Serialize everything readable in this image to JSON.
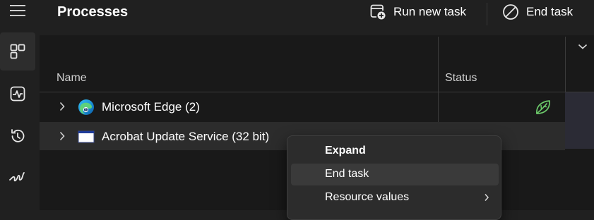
{
  "nav": {
    "items": [
      {
        "icon": "hamburger-menu-icon"
      },
      {
        "icon": "processes-icon",
        "selected": true
      },
      {
        "icon": "performance-icon"
      },
      {
        "icon": "app-history-icon"
      },
      {
        "icon": "startup-apps-icon"
      }
    ]
  },
  "header": {
    "title": "Processes",
    "run_new_task_label": "Run new task",
    "end_task_label": "End task"
  },
  "table": {
    "columns": [
      "Name",
      "Status"
    ],
    "rows": [
      {
        "name": "Microsoft Edge (2)",
        "icon": "edge-icon",
        "status_icon": "efficiency-mode-leaf-icon"
      },
      {
        "name": "Acrobat Update Service (32 bit)",
        "icon": "app-window-icon"
      }
    ]
  },
  "context_menu": {
    "items": [
      {
        "label": "Expand",
        "bold": true
      },
      {
        "label": "End task",
        "highlighted": true
      },
      {
        "label": "Resource values",
        "has_submenu": true
      }
    ]
  },
  "colors": {
    "background": "#191919",
    "command_bar": "#202020",
    "menu_background": "#2c2c2c",
    "eco_green": "#6cc96a"
  }
}
